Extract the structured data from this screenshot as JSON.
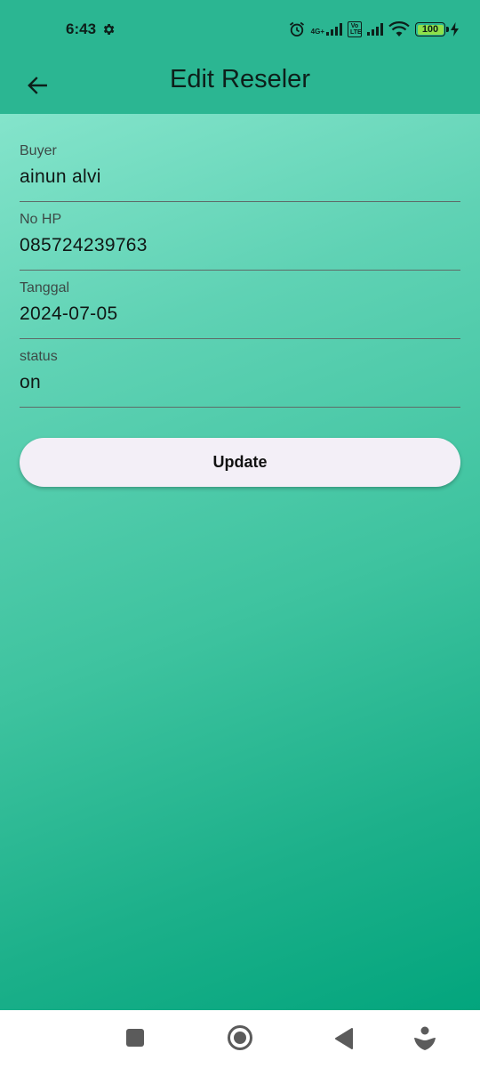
{
  "status_bar": {
    "time": "6:43",
    "network_label": "4G+",
    "volte_label": "Vo LTE",
    "battery": "100",
    "battery_color": "#8ee04a"
  },
  "app_bar": {
    "title": "Edit Reseler",
    "back_icon": "arrow-back-icon",
    "color": "#2bb692"
  },
  "form": {
    "fields": [
      {
        "label": "Buyer",
        "value": "ainun alvi"
      },
      {
        "label": "No HP",
        "value": "085724239763"
      },
      {
        "label": "Tanggal",
        "value": "2024-07-05"
      },
      {
        "label": "status",
        "value": "on"
      }
    ],
    "update_label": "Update"
  },
  "nav_bar": {
    "icons": [
      "recent-apps-icon",
      "home-icon",
      "back-triangle-icon",
      "assistant-icon"
    ]
  }
}
